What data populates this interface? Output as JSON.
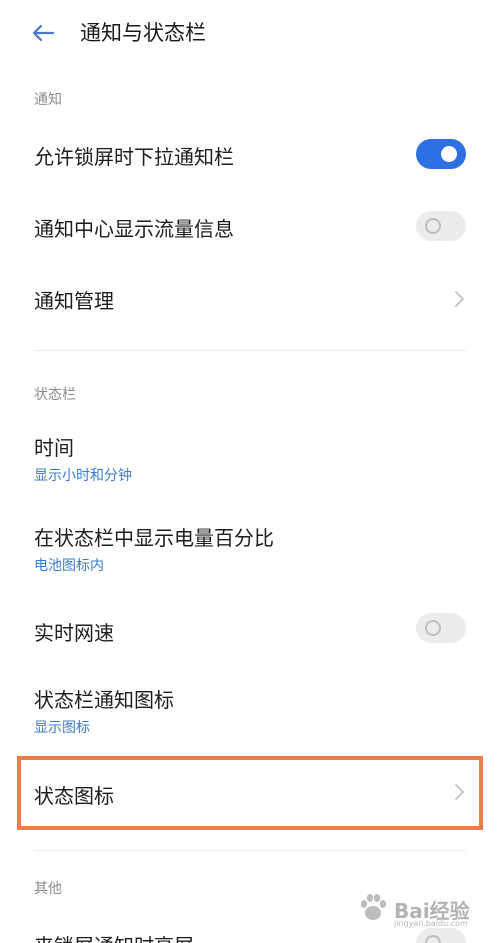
{
  "header": {
    "title": "通知与状态栏"
  },
  "sections": {
    "notifications": {
      "title": "通知",
      "allow_lockscreen_pull": {
        "label": "允许锁屏时下拉通知栏",
        "enabled": true
      },
      "show_data_usage": {
        "label": "通知中心显示流量信息",
        "enabled": false
      },
      "notification_manage": {
        "label": "通知管理"
      }
    },
    "statusbar": {
      "title": "状态栏",
      "time": {
        "label": "时间",
        "value": "显示小时和分钟"
      },
      "battery_percent": {
        "label": "在状态栏中显示电量百分比",
        "value": "电池图标内"
      },
      "realtime_speed": {
        "label": "实时网速",
        "enabled": false
      },
      "notification_icons": {
        "label": "状态栏通知图标",
        "value": "显示图标"
      },
      "status_icons": {
        "label": "状态图标"
      }
    },
    "other": {
      "title": "其他",
      "wake_on_notification": {
        "label": "来锁屏通知时亮屏",
        "enabled": false
      }
    }
  },
  "colors": {
    "accent": "#2f6fe4",
    "highlight": "#ef7a4a",
    "subtext": "#3a7bd5"
  },
  "watermark": {
    "text": "Bai经验",
    "subtext": "jingyan.baidu.com"
  }
}
